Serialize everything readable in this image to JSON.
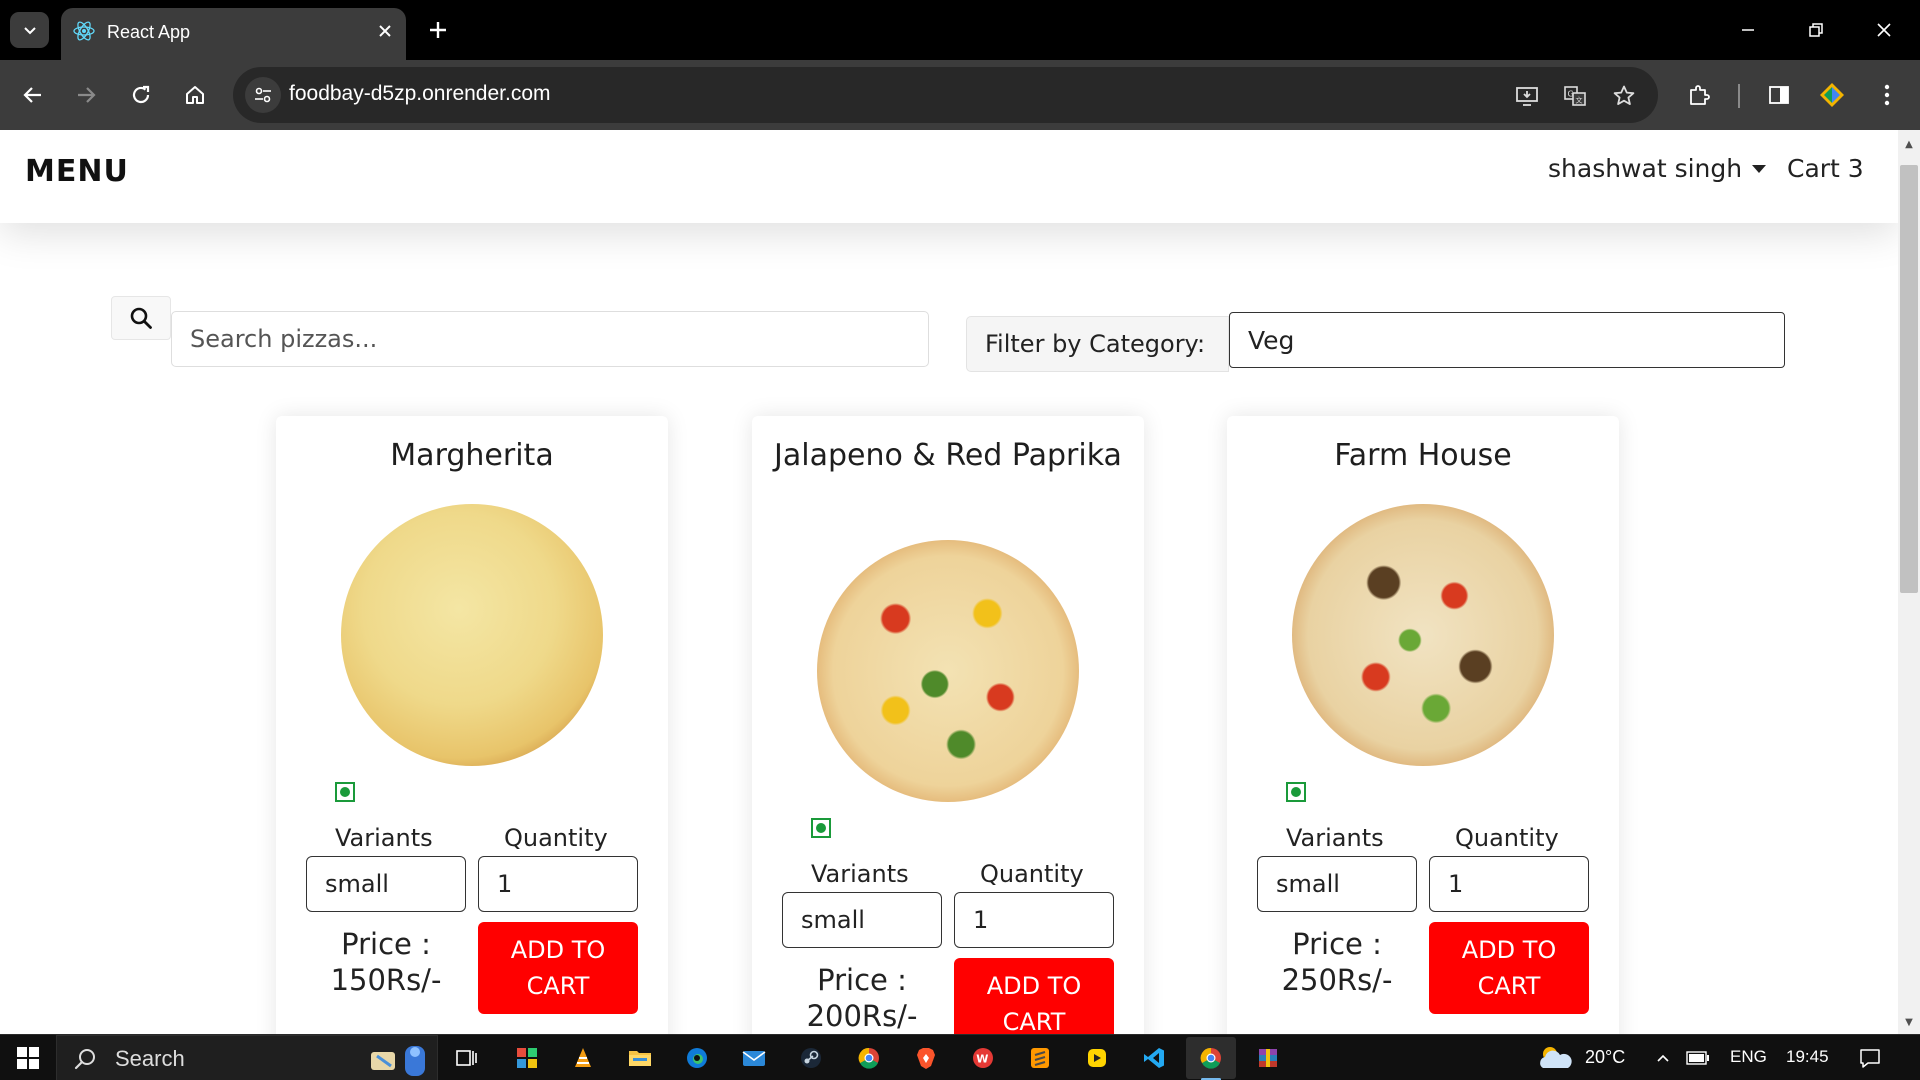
{
  "browser": {
    "tab_title": "React App",
    "url": "foodbay-d5zp.onrender.com"
  },
  "navbar": {
    "brand": "MENU",
    "user": "shashwat singh",
    "cart": "Cart 3"
  },
  "search": {
    "placeholder": "Search pizzas..."
  },
  "filter": {
    "label": "Filter by Category:",
    "value": "Veg"
  },
  "pizzas": [
    {
      "name": "Margherita",
      "variants_label": "Variants",
      "quantity_label": "Quantity",
      "variant": "small",
      "quantity": "1",
      "price_line1": "Price :",
      "price_line2": "150Rs/-",
      "button": "ADD TO CART",
      "category": "veg"
    },
    {
      "name": "Jalapeno & Red Paprika",
      "variants_label": "Variants",
      "quantity_label": "Quantity",
      "variant": "small",
      "quantity": "1",
      "price_line1": "Price :",
      "price_line2": "200Rs/-",
      "button": "ADD TO CART",
      "category": "veg"
    },
    {
      "name": "Farm House",
      "variants_label": "Variants",
      "quantity_label": "Quantity",
      "variant": "small",
      "quantity": "1",
      "price_line1": "Price :",
      "price_line2": "250Rs/-",
      "button": "ADD TO CART",
      "category": "veg"
    }
  ],
  "taskbar": {
    "search_label": "Search",
    "temperature": "20°C",
    "language": "ENG",
    "time": "19:45"
  },
  "colors": {
    "accent_button": "#ff0000",
    "veg_green": "#1a9a3a"
  }
}
